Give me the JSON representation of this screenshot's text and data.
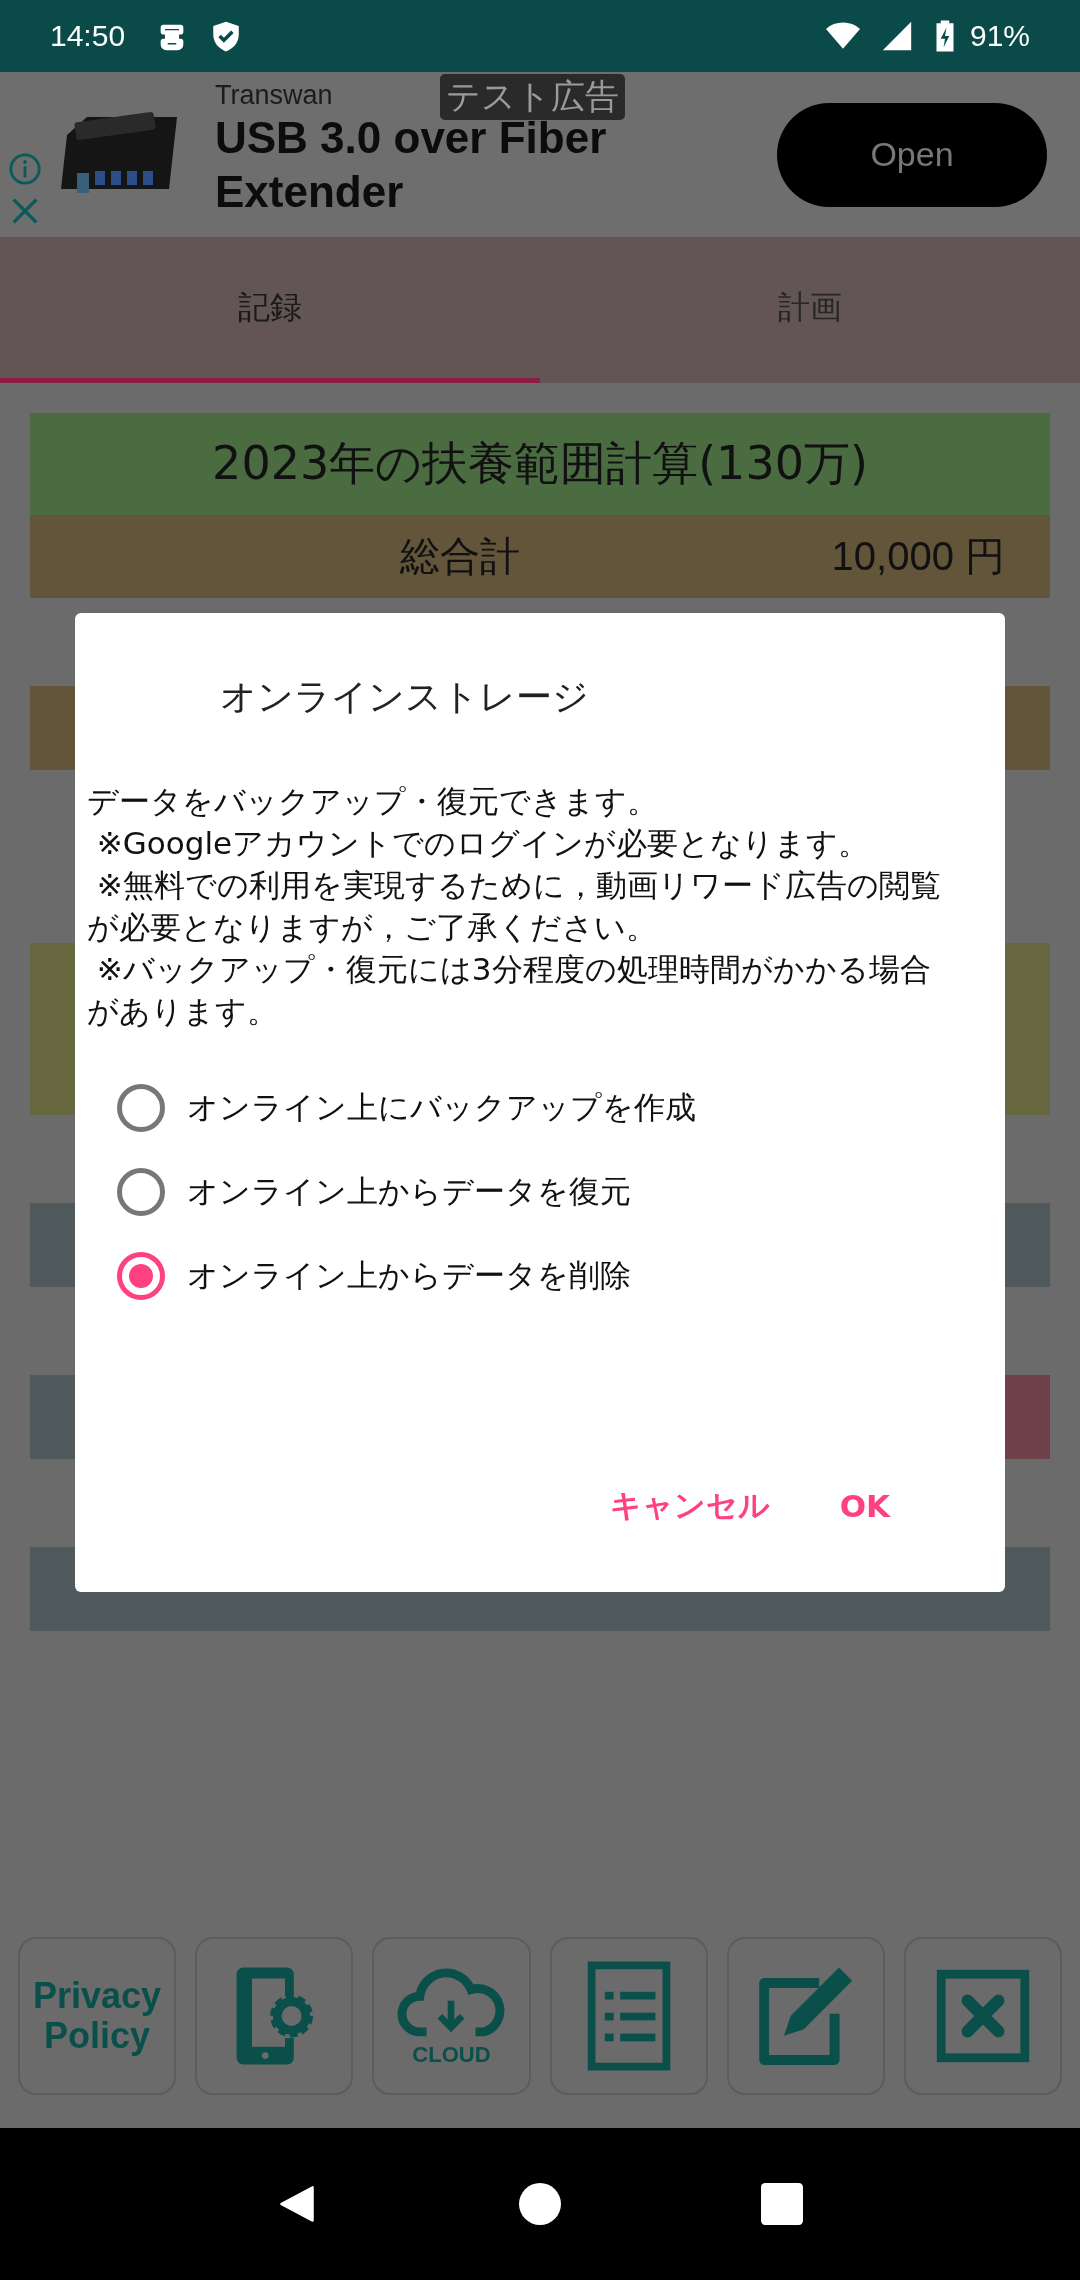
{
  "status_bar": {
    "time": "14:50",
    "battery": "91%"
  },
  "ad": {
    "advertiser": "Transwan",
    "badge": "テスト広告",
    "headline": "USB 3.0 over Fiber Extender",
    "button": "Open"
  },
  "tabs": [
    {
      "label": "記録",
      "selected": true
    },
    {
      "label": "計画",
      "selected": false
    }
  ],
  "summary": {
    "title": "2023年の扶養範囲計算(130万)",
    "total_label": "総合計",
    "total_value": "10,000 円"
  },
  "dialog": {
    "title": "オンラインストレージ",
    "message": "データをバックアップ・復元できます。\n ※Googleアカウントでのログインが必要となります。\n ※無料での利用を実現するために，動画リワード広告の閲覧が必要となりますが，ご了承ください。\n ※バックアップ・復元には3分程度の処理時間がかかる場合があります。",
    "options": [
      {
        "label": "オンライン上にバックアップを作成",
        "selected": false
      },
      {
        "label": "オンライン上からデータを復元",
        "selected": false
      },
      {
        "label": "オンライン上からデータを削除",
        "selected": true
      }
    ],
    "buttons": [
      "キャンセル",
      "OK"
    ]
  },
  "toolbar": [
    {
      "kind": "text",
      "label": "Privacy Policy"
    },
    {
      "kind": "phone-settings"
    },
    {
      "kind": "cloud",
      "label": "CLOUD"
    },
    {
      "kind": "list"
    },
    {
      "kind": "edit"
    },
    {
      "kind": "close"
    }
  ]
}
